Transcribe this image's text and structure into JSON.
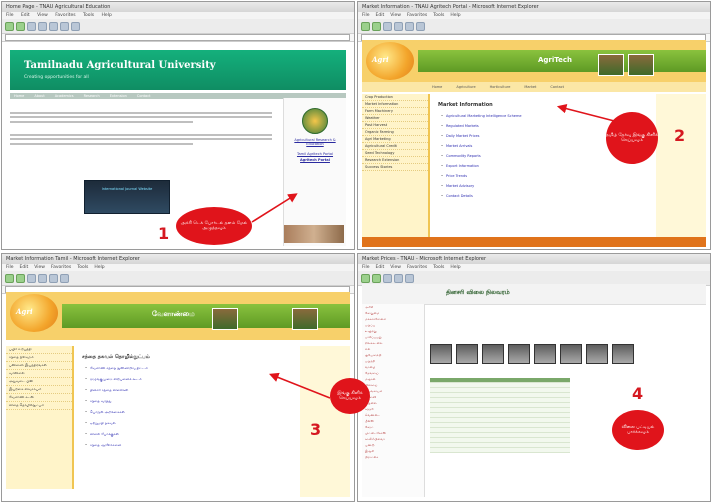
{
  "panel1": {
    "window_title": "Home Page - TNAU Agricultural Education",
    "menu": [
      "File",
      "Edit",
      "View",
      "Favorites",
      "Tools",
      "Help"
    ],
    "banner_title": "Tamilnadu Agricultural University",
    "banner_subtitle": "Creating opportunities for all",
    "nav_items": [
      "Home",
      "About",
      "Academics",
      "Research",
      "Extension",
      "Contact"
    ],
    "sidebar_link_1": "Agricultural Research & Education",
    "sidebar_link_2": "Tamil Agritech Portal",
    "sidebar_link_3": "Agritech Portal",
    "dark_box_text": "International Journal Website",
    "callout_text": "அக்ரி டெக் போர்டல் தளம் மேல் அழுத்தவும்",
    "number": "1"
  },
  "panel2": {
    "window_title": "Market Information - TNAU Agritech Portal - Microsoft Internet Explorer",
    "logo_text": "Agri",
    "banner_title": "AgriTech",
    "nav_items": [
      "Home",
      "Agriculture",
      "Horticulture",
      "Market",
      "Contact"
    ],
    "left_nav": [
      "Crop Production",
      "Market Information",
      "Farm Machinery",
      "Weather",
      "Post Harvest",
      "Organic Farming",
      "Agri Marketing",
      "Agricultural Credit",
      "Seed Technology",
      "Research Extension",
      "Success Stories"
    ],
    "content_heading": "Market Information",
    "bullets": [
      "Agricultural Marketing Intelligence Scheme",
      "Regulated Markets",
      "Daily Market Prices",
      "Market Arrivals",
      "Commodity Reports",
      "Export Information",
      "Price Trends",
      "Market Advisory",
      "Contact Details"
    ],
    "callout_text": "தமிழ் தேர்வு இங்கு கிளிக் செய்யவும்",
    "number": "2"
  },
  "panel3": {
    "window_title": "Market Information Tamil - Microsoft Internet Explorer",
    "logo_text": "Agri",
    "banner_title": "வேளாண்மை",
    "left_nav": [
      "பயிர் உற்பத்தி",
      "சந்தை நிலவரம்",
      "பண்ணை இயந்திரங்கள்",
      "வானிலை",
      "அறுவடை பின்",
      "இயற்கை விவசாயம்",
      "வேளாண் கடன்",
      "விதை தொழில்நுட்பம்"
    ],
    "content_heading": "சந்தை தகவல் தொழில்நுட்பம்",
    "bullets": [
      "வேளாண் சந்தை நுண்ணறிவு திட்டம்",
      "ஒழுங்குமுறை விற்பனைக் கூடம்",
      "தினசரி சந்தை விலைகள்",
      "சந்தை வரத்து",
      "பொருள் அறிக்கைகள்",
      "ஏற்றுமதி தகவல்",
      "விலை போக்குகள்",
      "சந்தை ஆலோசனை"
    ],
    "callout_text": "இங்கு கிளிக் செய்யவும்",
    "number": "3"
  },
  "panel4": {
    "window_title": "Market Prices - TNAU - Microsoft Internet Explorer",
    "header_title": "தினசரி விலை நிலவரம்",
    "left_items": [
      "அரிசி",
      "கோதுமை",
      "மக்காச்சோளம்",
      "பருப்பு",
      "உளுந்து",
      "பாசிப்பயறு",
      "நிலக்கடலை",
      "எள்",
      "சூரியகாந்தி",
      "பருத்தி",
      "வாழை",
      "தேங்காய்",
      "மஞ்சள்",
      "மிளகாய்",
      "வெங்காயம்",
      "தக்காளி",
      "உருளை",
      "கத்தரி",
      "வெண்டை",
      "பீன்ஸ்",
      "கேரட்",
      "முட்டைகோஸ்",
      "காலிஃபிளவர்",
      "பூண்டு",
      "இஞ்சி",
      "திராட்சை"
    ],
    "callout_text": "விலை பட்டியல் பார்க்கவும்",
    "number": "4"
  },
  "colors": {
    "callout_red": "#e0141b",
    "tnau_green": "#14b07c",
    "agri_orange": "#f3a52b",
    "agri_green": "#8ac23e"
  }
}
